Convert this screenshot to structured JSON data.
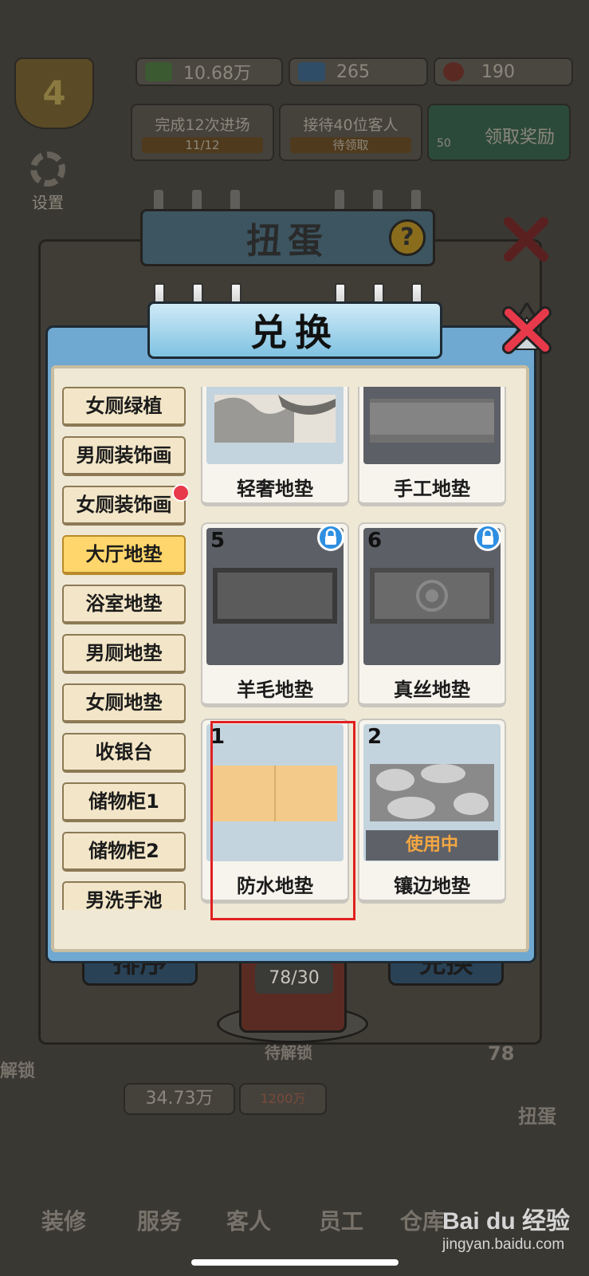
{
  "hud": {
    "level": "4",
    "cash": "10.68万",
    "gems": "265",
    "tickets": "190",
    "quests": [
      {
        "title": "完成12次进场",
        "progress": "11/12"
      },
      {
        "title": "接待40位客人",
        "progress": "待领取"
      }
    ],
    "reward_gems": "50",
    "reward_label": "领取奖励",
    "settings_label": "设置"
  },
  "gacha": {
    "title": "扭蛋",
    "help_icon": "question-icon",
    "sort_label": "排序",
    "exchange_label": "兑换",
    "counter": "78/30",
    "unlock_label": "待解锁",
    "side_count": "78",
    "side_label": "扭蛋"
  },
  "bottom": {
    "money": "34.73万",
    "money2": "1200万",
    "unlock_text": "解锁",
    "nav": [
      "装修",
      "服务",
      "客人",
      "员工",
      "仓库"
    ]
  },
  "exchange": {
    "title": "兑换",
    "categories": [
      {
        "label": "女厕绿植"
      },
      {
        "label": "男厕装饰画"
      },
      {
        "label": "女厕装饰画"
      },
      {
        "label": "大厅地垫"
      },
      {
        "label": "浴室地垫"
      },
      {
        "label": "男厕地垫"
      },
      {
        "label": "女厕地垫"
      },
      {
        "label": "收银台"
      },
      {
        "label": "储物柜1"
      },
      {
        "label": "储物柜2"
      },
      {
        "label": "男洗手池"
      }
    ],
    "active_category": "大厅地垫",
    "items": [
      {
        "num": "",
        "name": "轻奢地垫"
      },
      {
        "num": "",
        "name": "手工地垫"
      },
      {
        "num": "5",
        "name": "羊毛地垫",
        "locked": true
      },
      {
        "num": "6",
        "name": "真丝地垫",
        "locked": true
      },
      {
        "num": "1",
        "name": "防水地垫"
      },
      {
        "num": "2",
        "name": "镶边地垫",
        "status": "使用中"
      }
    ]
  },
  "watermark": {
    "brand": "Bai du 经验",
    "url": "jingyan.baidu.com"
  },
  "colors": {
    "accent_blue": "#6fa8d0",
    "active_tab": "#ffd66b",
    "highlight_red": "#e02020",
    "in_use_text": "#f5a742"
  }
}
